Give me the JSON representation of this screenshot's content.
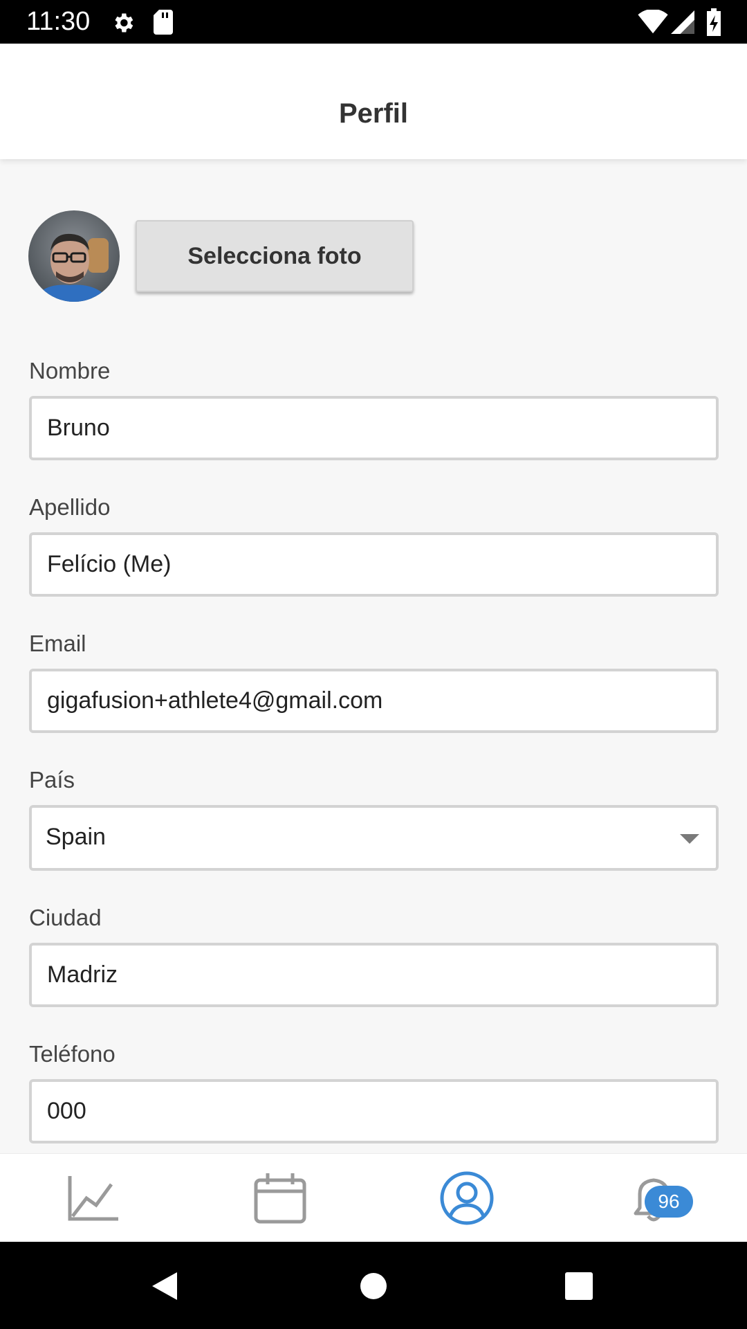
{
  "status_bar": {
    "time": "11:30",
    "icons": [
      "gear-icon",
      "sd-card-icon",
      "wifi-icon",
      "signal-icon",
      "battery-charging-icon"
    ]
  },
  "header": {
    "title": "Perfil"
  },
  "profile_photo": {
    "button_label": "Selecciona foto"
  },
  "form": {
    "nombre": {
      "label": "Nombre",
      "value": "Bruno"
    },
    "apellido": {
      "label": "Apellido",
      "value": "Felício (Me)"
    },
    "email": {
      "label": "Email",
      "value": "gigafusion+athlete4@gmail.com"
    },
    "pais": {
      "label": "País",
      "value": "Spain"
    },
    "ciudad": {
      "label": "Ciudad",
      "value": "Madriz"
    },
    "telefono": {
      "label": "Teléfono",
      "value": "000"
    }
  },
  "bottom_nav": {
    "items": [
      {
        "icon": "chart-line-icon",
        "active": false
      },
      {
        "icon": "calendar-icon",
        "active": false
      },
      {
        "icon": "profile-icon",
        "active": true
      },
      {
        "icon": "bell-icon",
        "active": false,
        "badge": "96"
      }
    ],
    "active_color": "#3b8ad6",
    "inactive_color": "#9a9a9a"
  },
  "system_nav": {
    "icons": [
      "back-icon",
      "home-icon",
      "recents-icon"
    ]
  }
}
